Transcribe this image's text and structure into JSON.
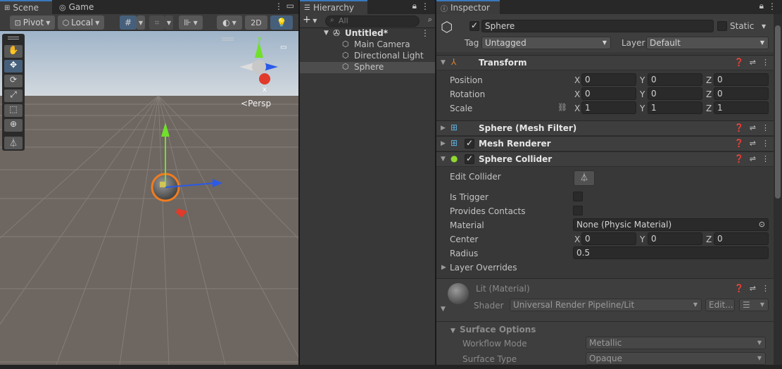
{
  "scene": {
    "tabs": [
      "Scene",
      "Game"
    ],
    "pivot_label": "Pivot",
    "local_label": "Local",
    "mode_2d": "2D",
    "persp_label": "Persp",
    "tools": [
      "hand-tool",
      "move-tool",
      "rotate-tool",
      "scale-tool",
      "rect-tool",
      "transform-tool",
      "custom-tool"
    ]
  },
  "hierarchy": {
    "tab": "Hierarchy",
    "search_placeholder": "All",
    "root": "Untitled*",
    "items": [
      "Main Camera",
      "Directional Light",
      "Sphere"
    ],
    "selected": "Sphere"
  },
  "inspector": {
    "tab": "Inspector",
    "object_name": "Sphere",
    "static_label": "Static",
    "tag_label": "Tag",
    "tag_value": "Untagged",
    "layer_label": "Layer",
    "layer_value": "Default",
    "transform": {
      "title": "Transform",
      "position_label": "Position",
      "rotation_label": "Rotation",
      "scale_label": "Scale",
      "position": {
        "x": "0",
        "y": "0",
        "z": "0"
      },
      "rotation": {
        "x": "0",
        "y": "0",
        "z": "0"
      },
      "scale": {
        "x": "1",
        "y": "1",
        "z": "1"
      }
    },
    "mesh_filter_title": "Sphere (Mesh Filter)",
    "mesh_renderer_title": "Mesh Renderer",
    "collider": {
      "title": "Sphere Collider",
      "edit_collider_label": "Edit Collider",
      "is_trigger_label": "Is Trigger",
      "provides_contacts_label": "Provides Contacts",
      "material_label": "Material",
      "material_value": "None (Physic Material)",
      "center_label": "Center",
      "center": {
        "x": "0",
        "y": "0",
        "z": "0"
      },
      "radius_label": "Radius",
      "radius_value": "0.5",
      "layer_overrides_label": "Layer Overrides"
    },
    "material": {
      "name": "Lit (Material)",
      "shader_label": "Shader",
      "shader_value": "Universal Render Pipeline/Lit",
      "edit_label": "Edit...",
      "surface_options_label": "Surface Options",
      "workflow_mode_label": "Workflow Mode",
      "workflow_mode_value": "Metallic",
      "surface_type_label": "Surface Type",
      "surface_type_value": "Opaque"
    },
    "axis_labels": {
      "x": "X",
      "y": "Y",
      "z": "Z"
    }
  },
  "colors": {
    "accent": "#3a79bb",
    "selection_orange": "#f07c20",
    "gizmo_x": "#e13a2a",
    "gizmo_y": "#70e02a",
    "gizmo_z": "#2a5ae8"
  }
}
